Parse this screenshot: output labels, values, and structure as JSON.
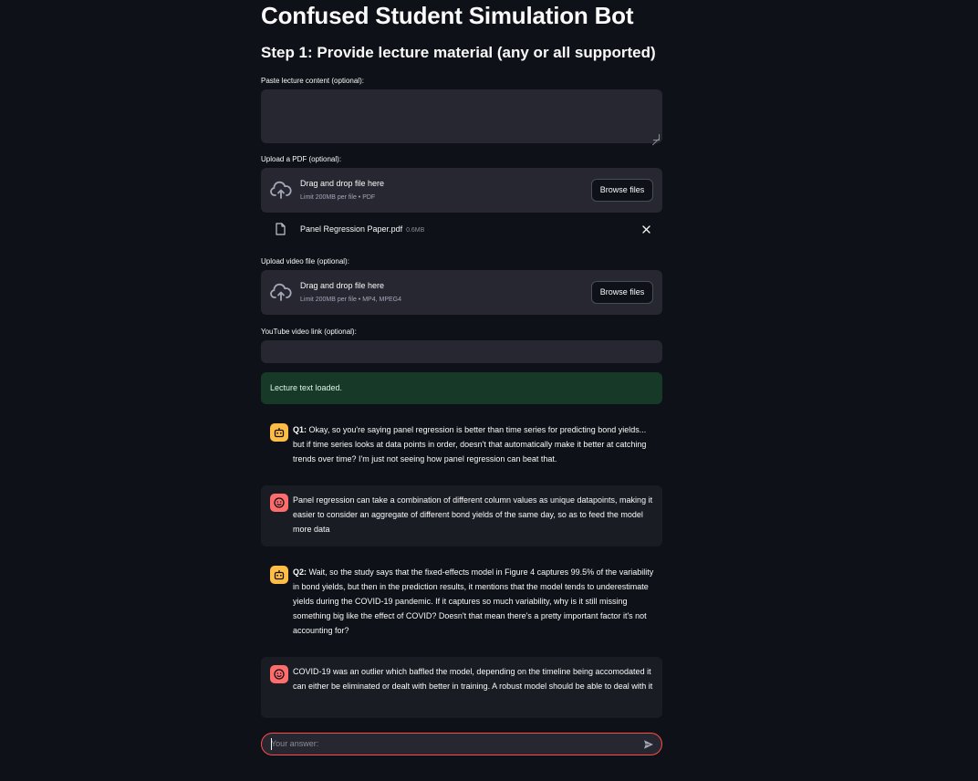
{
  "header": {
    "title": "Confused Student Simulation Bot",
    "step_heading": "Step 1: Provide lecture material (any or all supported)"
  },
  "lecture_text": {
    "label": "Paste lecture content (optional):",
    "value": ""
  },
  "pdf_upload": {
    "label": "Upload a PDF (optional):",
    "drop_title": "Drag and drop file here",
    "limit": "Limit 200MB per file • PDF",
    "browse_label": "Browse files",
    "file": {
      "name": "Panel Regression Paper.pdf",
      "size": "0.6MB"
    }
  },
  "video_upload": {
    "label": "Upload video file (optional):",
    "drop_title": "Drag and drop file here",
    "limit": "Limit 200MB per file • MP4, MPEG4",
    "browse_label": "Browse files"
  },
  "youtube": {
    "label": "YouTube video link (optional):",
    "value": ""
  },
  "status": {
    "success": "Lecture text loaded."
  },
  "messages": [
    {
      "role": "bot",
      "prefix": "Q1:",
      "text": " Okay, so you're saying panel regression is better than time series for predicting bond yields... but if time series looks at data points in order, doesn't that automatically make it better at catching trends over time? I'm just not seeing how panel regression can beat that."
    },
    {
      "role": "user",
      "text": "Panel regression can take a combination of different column values as unique datapoints, making it easier to consider an aggregate of different bond yields of the same day, so as to feed the model more data"
    },
    {
      "role": "bot",
      "prefix": "Q2:",
      "text": " Wait, so the study says that the fixed-effects model in Figure 4 captures 99.5% of the variability in bond yields, but then in the prediction results, it mentions that the model tends to underestimate yields during the COVID-19 pandemic. If it captures so much variability, why is it still missing something big like the effect of COVID? Doesn't that mean there's a pretty important factor it's not accounting for?"
    },
    {
      "role": "user",
      "text": "COVID-19 was an outlier which baffled the model, depending on the timeline being accomodated it can either be eliminated or dealt with better in training. A robust model should be able to deal with it"
    }
  ],
  "chat_input": {
    "placeholder": "Your answer:"
  },
  "colors": {
    "background": "#0e1117",
    "widget": "#262730",
    "success_bg": "#173928",
    "bot_avatar": "#ffbd45",
    "user_avatar": "#ff6c6c",
    "accent": "#ff4b4b"
  }
}
